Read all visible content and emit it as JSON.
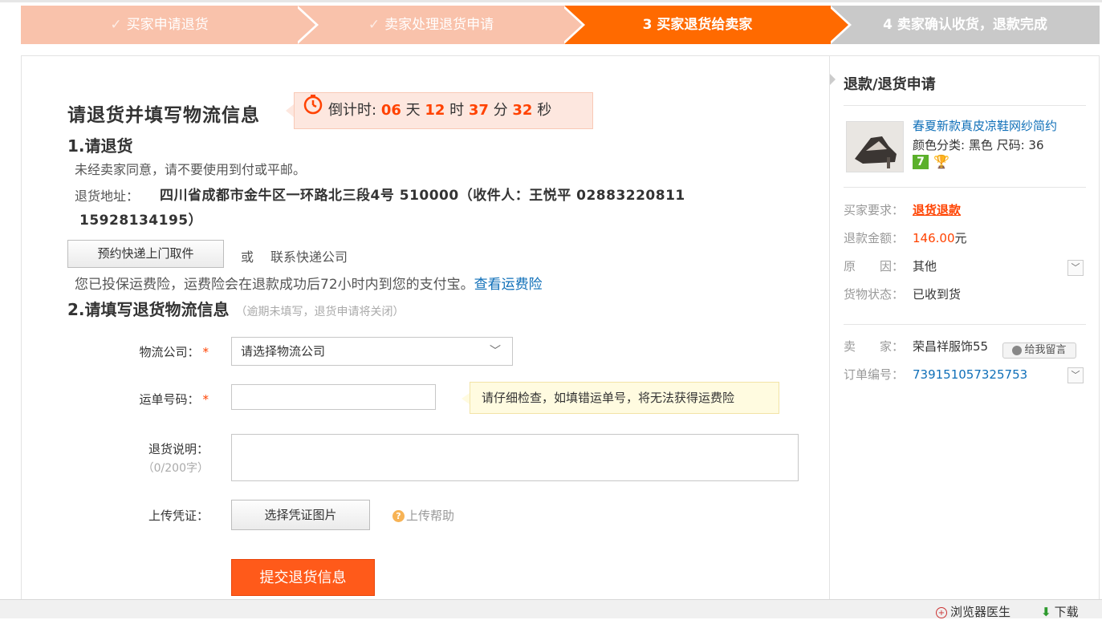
{
  "steps": [
    {
      "label": "买家申请退货",
      "state": "done"
    },
    {
      "label": "卖家处理退货申请",
      "state": "done"
    },
    {
      "label": "3  买家退货给卖家",
      "state": "current"
    },
    {
      "label": "4  卖家确认收货，退款完成",
      "state": "pending"
    }
  ],
  "main": {
    "title": "请退货并填写物流信息",
    "countdown": {
      "prefix": "倒计时:",
      "days": "06",
      "days_unit": "天",
      "hours": "12",
      "hours_unit": "时",
      "minutes": "37",
      "minutes_unit": "分",
      "seconds": "32",
      "seconds_unit": "秒"
    },
    "section1": {
      "heading": "1.请退货",
      "note": "未经卖家同意，请不要使用到付或平邮。",
      "address_label": "退货地址：",
      "address_line1": "四川省成都市金牛区一环路北三段4号 510000（收件人：王悦平 02883220811",
      "address_line2": "15928134195）",
      "pickup_button": "预约快递上门取件",
      "or_text": "或",
      "contact_text": "联系快递公司",
      "insurance_text": "您已投保运费险，运费险会在退款成功后72小时内到您的支付宝。",
      "insurance_link": "查看运费险"
    },
    "section2": {
      "heading": "2.请填写退货物流信息",
      "hint": "（逾期未填写，退货申请将关闭）",
      "logistics_label": "物流公司：",
      "logistics_placeholder": "请选择物流公司",
      "tracking_label": "运单号码：",
      "tracking_value": "",
      "tracking_tip": "请仔细检查，如填错运单号，将无法获得运费险",
      "remark_label": "退货说明：",
      "remark_counter": "（0/200字）",
      "remark_value": "",
      "upload_label": "上传凭证：",
      "upload_button": "选择凭证图片",
      "upload_help": "上传帮助",
      "submit_button": "提交退货信息"
    }
  },
  "sidebar": {
    "title": "退款/退货申请",
    "product": {
      "name": "春夏新款真皮凉鞋网纱简约",
      "attrs": "颜色分类: 黑色 尺码: 36",
      "badge": "7"
    },
    "buyer_request_label": "买家要求：",
    "buyer_request": "退货退款",
    "refund_label": "退款金额：",
    "refund_amount": "146.00",
    "refund_unit": "元",
    "reason_label": "原　　因：",
    "reason": "其他",
    "goods_status_label": "货物状态：",
    "goods_status": "已收到货",
    "seller_label": "卖　　家：",
    "seller": "荣昌祥服饰55",
    "message_button": "给我留言",
    "order_label": "订单编号：",
    "order_no": "739151057325753"
  },
  "statusbar": {
    "doctor": "浏览器医生",
    "download": "下载"
  },
  "colors": {
    "accent": "#ff6a00",
    "done_step": "#f9c2ab",
    "pending_step": "#c9c9c9",
    "link": "#0f6fb8",
    "highlight": "#ff4200"
  }
}
